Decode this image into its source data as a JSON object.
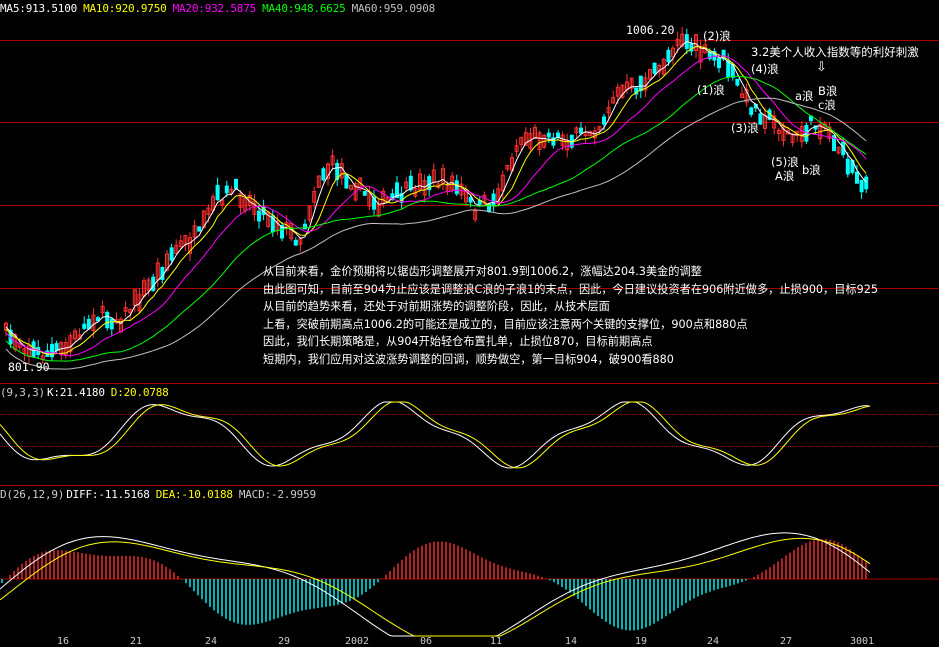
{
  "price_pane": {
    "legend": {
      "ma5": "MA5:913.5100",
      "ma10": "MA10:920.9750",
      "ma20": "MA20:932.5875",
      "ma40": "MA40:948.6625",
      "ma60": "MA60:959.0908"
    },
    "high_label": "1006.20",
    "low_label": "801.90",
    "wave_labels": {
      "w2": "(2)浪",
      "w1": "(1)浪",
      "w4": "(4)浪",
      "w3": "(3)浪",
      "w5": "(5)浪",
      "wA": "A浪",
      "wa": "a浪",
      "wb": "b浪",
      "wB": "B浪",
      "wc": "c浪",
      "news": "3.2美个人收入指数等的利好刺激",
      "arrow": "⇩"
    },
    "commentary": [
      "从目前来看，金价预期将以锯齿形调整展开对801.9到1006.2，涨幅达204.3美金的调整",
      "由此图可知，目前至904为止应该是调整浪C浪的子浪1的末点，因此，今日建议投资者在906附近做多，止损900，目标925",
      "从目前的趋势来看，还处于对前期涨势的调整阶段，因此，从技术层面",
      "上看，突破前期高点1006.2的可能还是成立的，目前应该注意两个关键的支撑位，900点和880点",
      "因此，我们长期策略是，从904开始轻仓布置扎单，止损位870，目标前期高点",
      "短期内，我们应用对这波涨势调整的回调，顺势做空，第一目标904，破900看880"
    ]
  },
  "kdj_pane": {
    "params": "(9,3,3)",
    "k": "K:21.4180",
    "d": "D:20.0788"
  },
  "macd_pane": {
    "params": "D(26,12,9)",
    "diff": "DIFF:-11.5168",
    "dea": "DEA:-10.0188",
    "macd": "MACD:-2.9959"
  },
  "colors": {
    "ma5": "#ffffff",
    "ma10": "#ffff00",
    "ma20": "#ff00ff",
    "ma40": "#00ff00",
    "ma60": "#c0c0c0",
    "up": "#ff3030",
    "down": "#00ffff",
    "grid": "#aa0000"
  },
  "x_axis": [
    "16",
    "21",
    "24",
    "29",
    "2002",
    "06",
    "11",
    "14",
    "19",
    "24",
    "27",
    "3001"
  ]
}
